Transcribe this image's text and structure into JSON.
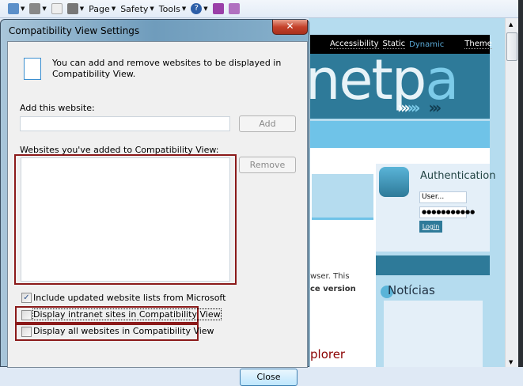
{
  "toolbar": {
    "items": [
      {
        "icon": "home-icon"
      },
      {
        "icon": "feeds-icon"
      },
      {
        "icon": "mail-icon"
      },
      {
        "icon": "print-icon"
      }
    ],
    "page_label": "Page",
    "safety_label": "Safety",
    "tools_label": "Tools",
    "help_icon": "help-icon",
    "onenote_icons": [
      "onenote-send-icon",
      "onenote-linked-icon"
    ]
  },
  "dialog": {
    "title": "Compatibility View Settings",
    "close_x": "✕",
    "description": "You can add and remove websites to be displayed in Compatibility View.",
    "add_label": "Add this website:",
    "add_value": "",
    "add_button": "Add",
    "list_label": "Websites you've added to Compatibility View:",
    "list_items": [],
    "remove_button": "Remove",
    "checkboxes": [
      {
        "label": "Include updated website lists from Microsoft",
        "checked": true
      },
      {
        "label": "Display intranet sites in Compatibility View",
        "checked": false
      },
      {
        "label": "Display all websites in Compatibility View",
        "checked": false
      }
    ],
    "close_button": "Close"
  },
  "webpage": {
    "nav": {
      "accessibility": "Accessibility",
      "static": "Static",
      "dynamic": "Dynamic",
      "theme": "Theme"
    },
    "logo_text": "netpa",
    "left_text_1": "wser. This",
    "left_text_2": "ce version",
    "left_red_text": "plorer",
    "auth": {
      "title": "Authentication",
      "user_placeholder": "User...",
      "password": "●●●●●●●●●●●",
      "login": "Login"
    },
    "news_title": "Notícias"
  },
  "colors": {
    "banner": "#2e7a99",
    "page_bg": "#b5dcef",
    "band": "#6fc3e8",
    "highlight": "#8b1a1a"
  }
}
